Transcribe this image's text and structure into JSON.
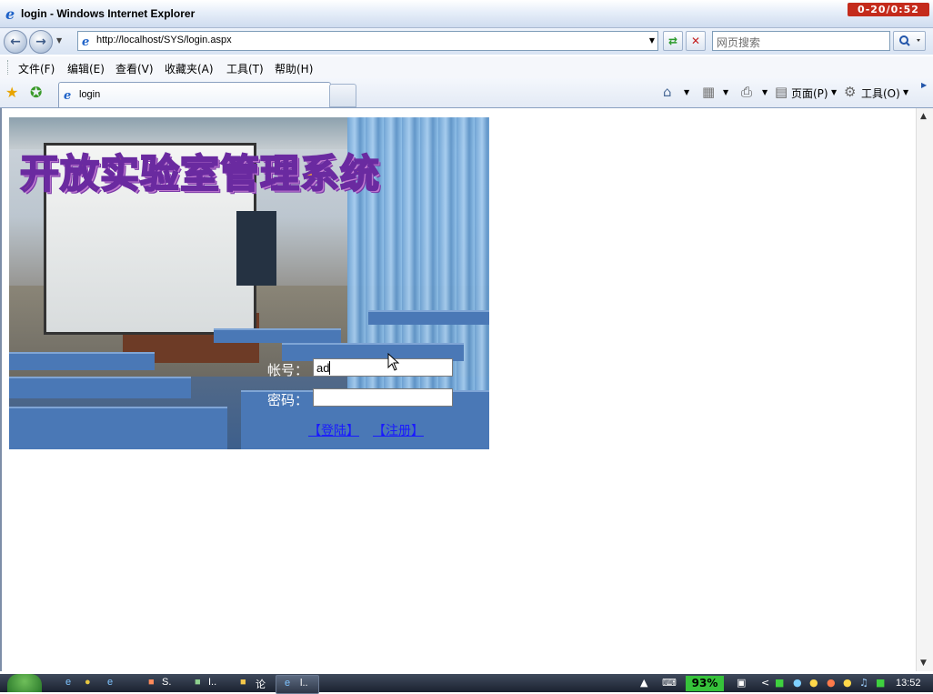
{
  "window": {
    "title": "login - Windows Internet Explorer",
    "controls_text": "0-20/0:52"
  },
  "address_bar": {
    "url": "http://localhost/SYS/login.aspx",
    "search_placeholder": "网页搜索"
  },
  "menu": {
    "items": [
      {
        "label": "文件(F)"
      },
      {
        "label": "编辑(E)"
      },
      {
        "label": "查看(V)"
      },
      {
        "label": "收藏夹(A)"
      },
      {
        "label": "工具(T)"
      },
      {
        "label": "帮助(H)"
      }
    ]
  },
  "tabs": {
    "active_label": "login"
  },
  "command_bar": {
    "page_label": "页面(P)",
    "tools_label": "工具(O)"
  },
  "page": {
    "banner_title": "开放实验室管理系统",
    "account_label": "帐号：",
    "account_value": "ad",
    "password_label": "密码：",
    "password_value": "",
    "login_link": "【登陆】",
    "register_link": "【注册】"
  },
  "taskbar": {
    "items": [
      {
        "label": "S."
      },
      {
        "label": "I.."
      },
      {
        "label": "论"
      },
      {
        "label": "l.."
      }
    ],
    "battery": "93%",
    "clock": "13:52"
  },
  "colors": {
    "link": "#1a1aff",
    "title_fill": "#f2a23a",
    "title_outline": "#6a2aa0",
    "battery": "#36c23a"
  }
}
